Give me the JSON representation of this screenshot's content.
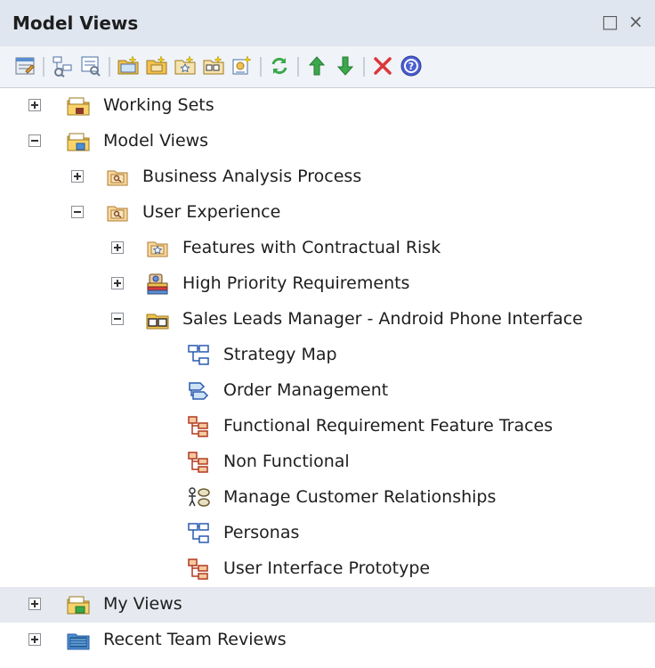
{
  "window": {
    "title": "Model Views",
    "restore_glyph": "□",
    "close_glyph": "×"
  },
  "toolbar": {
    "icons": [
      "properties-icon",
      "new-view-icon",
      "new-filtered-view-icon",
      "new-folder-icon",
      "new-search-folder-icon",
      "new-favorites-icon",
      "new-diagram-icon",
      "new-slideshow-icon",
      "refresh-icon",
      "move-up-icon",
      "move-down-icon",
      "delete-icon",
      "help-icon"
    ]
  },
  "tree": {
    "nodes": [
      {
        "label": "Working Sets",
        "level": 0,
        "expander": "plus",
        "icon": "working-sets-folder-icon"
      },
      {
        "label": "Model Views",
        "level": 0,
        "expander": "minus",
        "icon": "model-views-folder-icon"
      },
      {
        "label": "Business Analysis Process",
        "level": 1,
        "expander": "plus",
        "icon": "search-folder-icon"
      },
      {
        "label": "User Experience",
        "level": 1,
        "expander": "minus",
        "icon": "search-folder-icon"
      },
      {
        "label": "Features with Contractual Risk",
        "level": 2,
        "expander": "plus",
        "icon": "favorites-folder-icon"
      },
      {
        "label": "High Priority Requirements",
        "level": 2,
        "expander": "plus",
        "icon": "search-results-icon"
      },
      {
        "label": "Sales Leads Manager - Android Phone Interface",
        "level": 2,
        "expander": "minus",
        "icon": "slideshow-folder-icon"
      },
      {
        "label": "Strategy Map",
        "level": 3,
        "expander": "none",
        "icon": "blue-diagram-icon"
      },
      {
        "label": "Order Management",
        "level": 3,
        "expander": "none",
        "icon": "process-diagram-icon"
      },
      {
        "label": "Functional Requirement Feature Traces",
        "level": 3,
        "expander": "none",
        "icon": "requirements-diagram-icon"
      },
      {
        "label": "Non Functional",
        "level": 3,
        "expander": "none",
        "icon": "requirements-diagram-icon"
      },
      {
        "label": "Manage Customer Relationships",
        "level": 3,
        "expander": "none",
        "icon": "use-case-diagram-icon"
      },
      {
        "label": "Personas",
        "level": 3,
        "expander": "none",
        "icon": "blue-diagram-icon"
      },
      {
        "label": "User Interface Prototype",
        "level": 3,
        "expander": "none",
        "icon": "requirements-diagram-icon"
      },
      {
        "label": "My Views",
        "level": 0,
        "expander": "plus",
        "icon": "my-views-folder-icon",
        "highlighted": true
      },
      {
        "label": "Recent Team Reviews",
        "level": 0,
        "expander": "plus",
        "icon": "team-reviews-folder-icon"
      }
    ]
  },
  "colors": {
    "titlebar": "#dfe6f0",
    "highlight": "#e6eaf0",
    "folder_yellow": "#f2c14e",
    "folder_blue": "#4a8ed8",
    "red": "#d9383a",
    "green": "#3aa84b"
  }
}
